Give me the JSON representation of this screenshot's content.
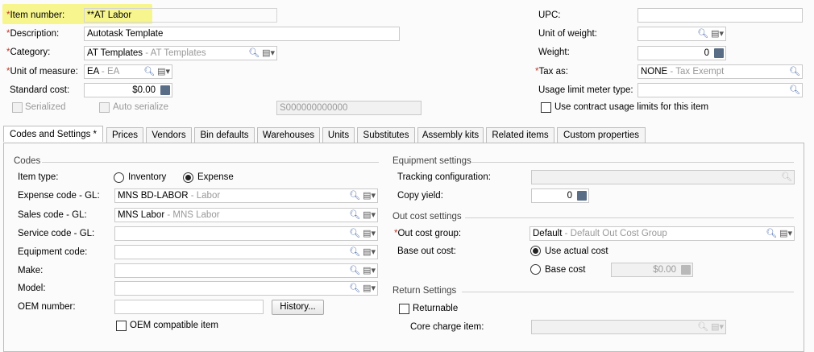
{
  "header": {
    "item_number_label": "Item number:",
    "item_number_value": "**AT Labor",
    "description_label": "Description:",
    "description_value": "Autotask Template",
    "category_label": "Category:",
    "category_value": "AT Templates",
    "category_sub": " - AT Templates",
    "uom_label": "Unit of measure:",
    "uom_value": "EA",
    "uom_sub": " - EA",
    "standard_cost_label": "Standard cost:",
    "standard_cost_value": "$0.00",
    "serialized_label": "Serialized",
    "auto_serialize_label": "Auto serialize",
    "serial_template_value": "S000000000000",
    "upc_label": "UPC:",
    "upc_value": "",
    "unit_of_weight_label": "Unit of weight:",
    "unit_of_weight_value": "",
    "weight_label": "Weight:",
    "weight_value": "0",
    "tax_as_label": "Tax as:",
    "tax_as_value": "NONE",
    "tax_as_sub": " - Tax Exempt",
    "usage_limit_label": "Usage limit meter type:",
    "usage_limit_value": "",
    "contract_usage_label": "Use contract usage limits for this item"
  },
  "tabs": [
    "Codes and Settings  *",
    "Prices",
    "Vendors",
    "Bin defaults",
    "Warehouses",
    "Units",
    "Substitutes",
    "Assembly kits",
    "Related items",
    "Custom properties"
  ],
  "codes": {
    "section_title": "Codes",
    "item_type_label": "Item type:",
    "inventory_label": "Inventory",
    "expense_label": "Expense",
    "expense_code_label": "Expense code - GL:",
    "expense_code_value": "MNS BD-LABOR",
    "expense_code_sub": " - Labor",
    "sales_code_label": "Sales code - GL:",
    "sales_code_value": "MNS Labor",
    "sales_code_sub": " - MNS Labor",
    "service_code_label": "Service code - GL:",
    "equipment_code_label": "Equipment code:",
    "make_label": "Make:",
    "model_label": "Model:",
    "oem_number_label": "OEM number:",
    "history_button": "History...",
    "oem_compatible_label": "OEM compatible item"
  },
  "equipment": {
    "section_title": "Equipment settings",
    "tracking_label": "Tracking configuration:",
    "copy_yield_label": "Copy yield:",
    "copy_yield_value": "0"
  },
  "outcost": {
    "section_title": "Out cost settings",
    "group_label": "Out cost group:",
    "group_value": "Default",
    "group_sub": " - Default Out Cost Group",
    "base_label": "Base out cost:",
    "use_actual_label": "Use actual cost",
    "base_cost_label": "Base cost",
    "base_cost_value": "$0.00"
  },
  "returns": {
    "section_title": "Return Settings",
    "returnable_label": "Returnable",
    "core_charge_label": "Core charge item:"
  }
}
